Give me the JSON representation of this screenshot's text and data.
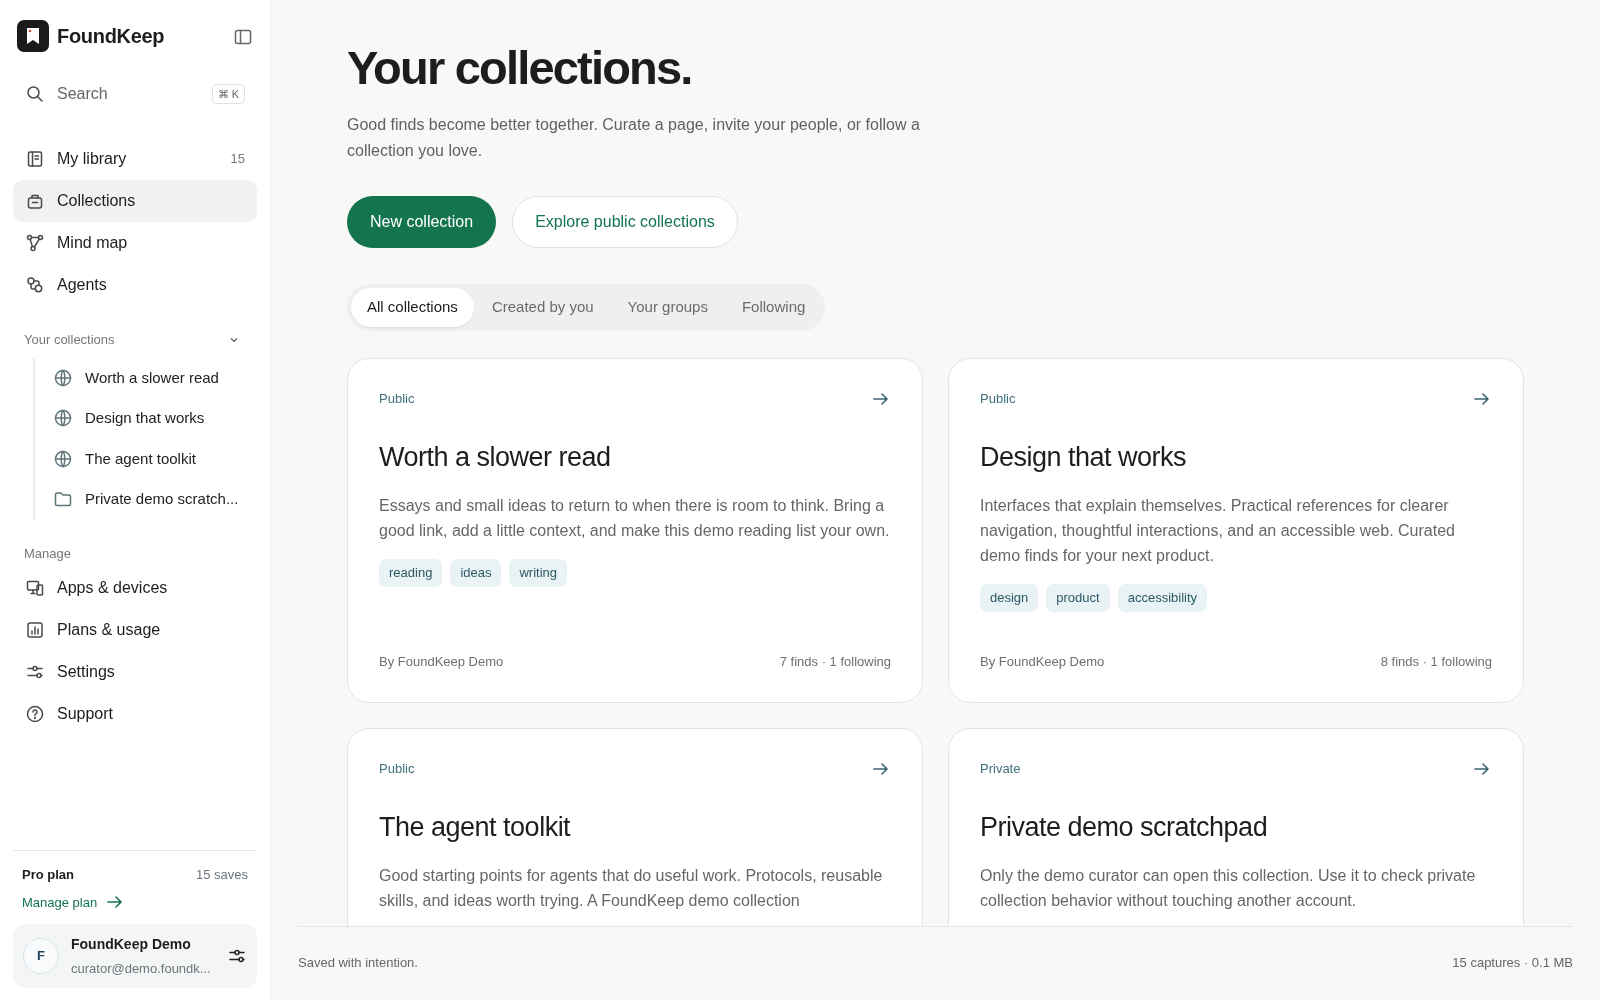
{
  "brand": {
    "name": "FoundKeep"
  },
  "search": {
    "placeholder": "Search",
    "shortcut": "⌘ K"
  },
  "nav": [
    {
      "label": "My library",
      "count": "15",
      "selected": false
    },
    {
      "label": "Collections",
      "selected": true
    },
    {
      "label": "Mind map",
      "selected": false
    },
    {
      "label": "Agents",
      "selected": false
    }
  ],
  "your_collections": {
    "title": "Your collections",
    "expanded": true,
    "items": [
      {
        "label": "Worth a slower read",
        "kind": "public"
      },
      {
        "label": "Design that works",
        "kind": "public"
      },
      {
        "label": "The agent toolkit",
        "kind": "public"
      },
      {
        "label": "Private demo scratch...",
        "kind": "private"
      }
    ]
  },
  "manage": {
    "title": "Manage",
    "items": [
      {
        "label": "Apps & devices"
      },
      {
        "label": "Plans & usage"
      },
      {
        "label": "Settings"
      },
      {
        "label": "Support"
      }
    ]
  },
  "plan": {
    "name": "Pro plan",
    "saves": "15 saves",
    "link": "Manage plan"
  },
  "user": {
    "initial": "F",
    "name": "FoundKeep Demo",
    "email": "curator@demo.foundk..."
  },
  "header": {
    "title": "Your collections.",
    "subtitle": "Good finds become better together. Curate a page, invite your people, or follow a collection you love."
  },
  "actions": [
    {
      "label": "New collection",
      "kind": "primary"
    },
    {
      "label": "Explore public collections",
      "kind": "outline"
    }
  ],
  "filters": [
    {
      "label": "All collections",
      "selected": true
    },
    {
      "label": "Created by you",
      "selected": false
    },
    {
      "label": "Your groups",
      "selected": false
    },
    {
      "label": "Following",
      "selected": false
    }
  ],
  "cards": [
    {
      "visibility": "Public",
      "title": "Worth a slower read",
      "description": "Essays and small ideas to return to when there is room to think. Bring a good link, add a little context, and make this demo reading list your own.",
      "tags": [
        "reading",
        "ideas",
        "writing"
      ],
      "author": "By FoundKeep Demo",
      "stats": "7 finds · 1 following"
    },
    {
      "visibility": "Public",
      "title": "Design that works",
      "description": "Interfaces that explain themselves. Practical references for clearer navigation, thoughtful interactions, and an accessible web. Curated demo finds for your next product.",
      "tags": [
        "design",
        "product",
        "accessibility"
      ],
      "author": "By FoundKeep Demo",
      "stats": "8 finds · 1 following"
    },
    {
      "visibility": "Public",
      "title": "The agent toolkit",
      "description": "Good starting points for agents that do useful work. Protocols, reusable skills, and ideas worth trying. A FoundKeep demo collection"
    },
    {
      "visibility": "Private",
      "title": "Private demo scratchpad",
      "description": "Only the demo curator can open this collection. Use it to check private collection behavior without touching another account."
    }
  ],
  "footer": {
    "left": "Saved with intention.",
    "right": "15 captures · 0.1 MB"
  }
}
